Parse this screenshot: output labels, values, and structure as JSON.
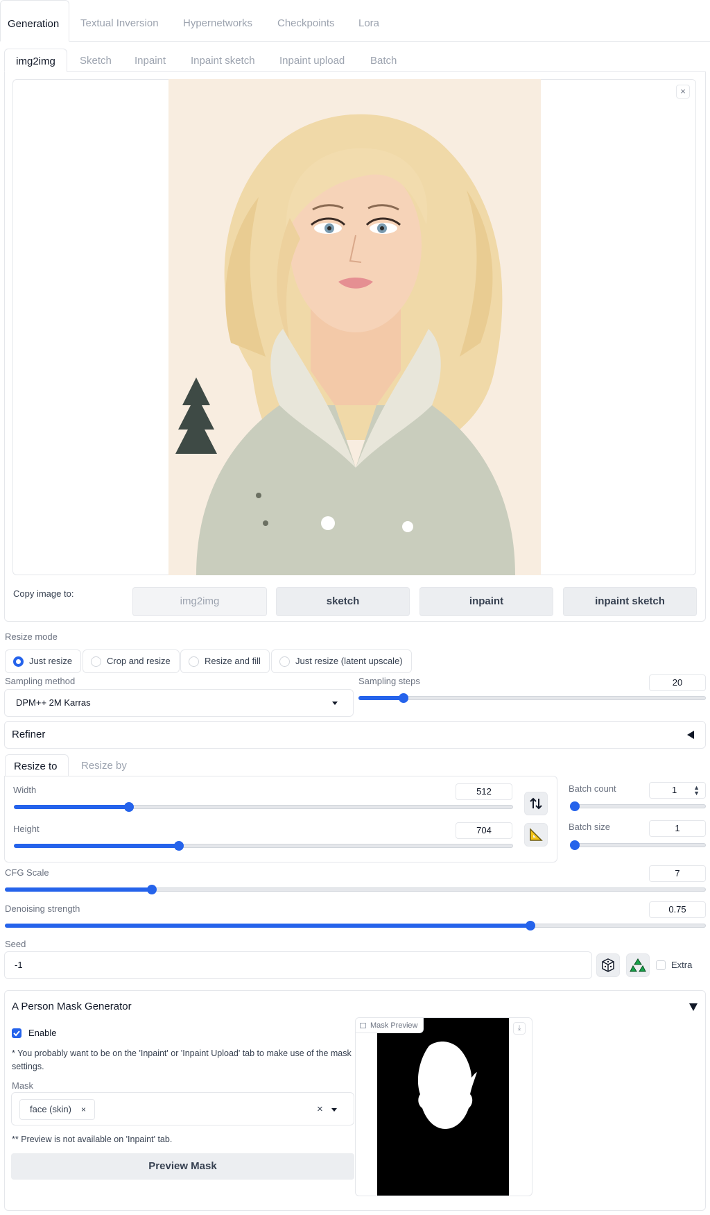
{
  "top_tabs": [
    "Generation",
    "Textual Inversion",
    "Hypernetworks",
    "Checkpoints",
    "Lora"
  ],
  "sub_tabs": [
    "img2img",
    "Sketch",
    "Inpaint",
    "Inpaint sketch",
    "Inpaint upload",
    "Batch"
  ],
  "image_panel": {
    "close_icon": "×"
  },
  "copy_image": {
    "label": "Copy image to:",
    "buttons": [
      "img2img",
      "sketch",
      "inpaint",
      "inpaint sketch"
    ]
  },
  "resize_mode": {
    "label": "Resize mode",
    "options": [
      "Just resize",
      "Crop and resize",
      "Resize and fill",
      "Just resize (latent upscale)"
    ],
    "selected": "Just resize"
  },
  "sampling": {
    "method_label": "Sampling method",
    "method_value": "DPM++ 2M Karras",
    "steps_label": "Sampling steps",
    "steps_value": "20",
    "steps_fraction": 0.13
  },
  "refiner": {
    "label": "Refiner"
  },
  "resize_tabs": [
    "Resize to",
    "Resize by"
  ],
  "dimensions": {
    "width_label": "Width",
    "width_value": "512",
    "width_fraction": 0.23,
    "height_label": "Height",
    "height_value": "704",
    "height_fraction": 0.33
  },
  "batch": {
    "count_label": "Batch count",
    "count_value": "1",
    "size_label": "Batch size",
    "size_value": "1"
  },
  "cfg": {
    "label": "CFG Scale",
    "value": "7",
    "fraction": 0.21
  },
  "denoise": {
    "label": "Denoising strength",
    "value": "0.75",
    "fraction": 0.75
  },
  "seed": {
    "label": "Seed",
    "value": "-1",
    "extra_label": "Extra"
  },
  "mask_generator": {
    "title": "A Person Mask Generator",
    "enable_label": "Enable",
    "note": "* You probably want to be on the 'Inpaint' or 'Inpaint Upload' tab to make use of the mask settings.",
    "mask_label": "Mask",
    "mask_tag": "face (skin)",
    "preview_note": "** Preview is not available on 'Inpaint' tab.",
    "preview_button": "Preview Mask",
    "preview_label": "Mask Preview"
  },
  "colors": {
    "accent": "#2563eb",
    "border": "#e5e7eb"
  }
}
